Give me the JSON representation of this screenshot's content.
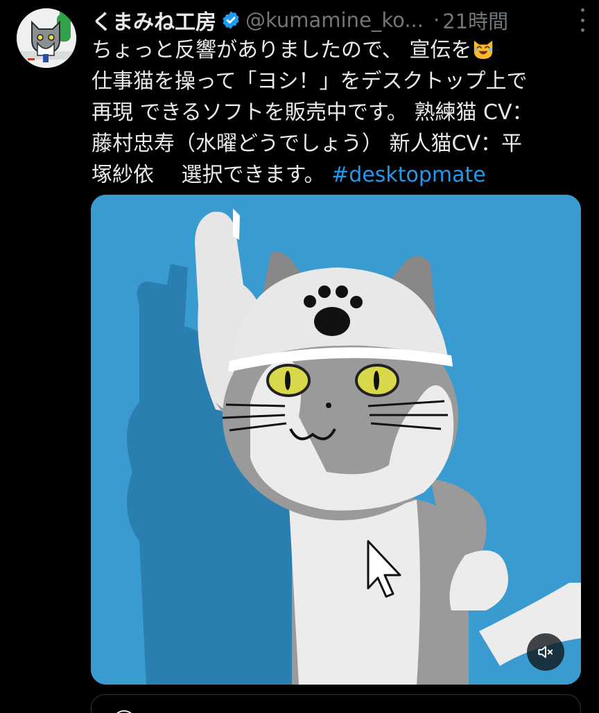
{
  "tweet": {
    "display_name": "くまみね工房",
    "handle": "@kumamine_ko...",
    "separator": "·",
    "time": "21時間",
    "verified_icon": "verified-badge-icon",
    "more_icon": "more-vertical-icon",
    "text": {
      "line1_before_emoji": "ちょっと反響がありましたので、 宣伝を",
      "line1_emoji": "laughing-cat-emoji",
      "line2": "仕事猫を操って「ヨシ！」をデスクトップ上で",
      "line3": "再現 できるソフトを販売中です。 熟練猫 CV：",
      "line4": "藤村忠寿（水曜どうでしょう） 新人猫CV：平",
      "line5_text": "塚紗依　 選択できます。 ",
      "hashtag": "#desktopmate"
    },
    "media": {
      "description_icon": "video-player",
      "mute_icon": "volume-muted-icon"
    }
  },
  "colors": {
    "background": "#000000",
    "text": "#e7e9ea",
    "secondary": "#71767b",
    "accent": "#1d9bf0",
    "media_bg": "#3a9bd0"
  }
}
